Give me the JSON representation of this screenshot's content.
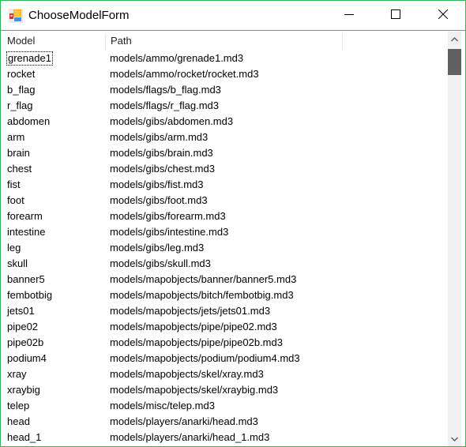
{
  "window": {
    "title": "ChooseModelForm",
    "icon": "app-form-icon",
    "controls": {
      "minimize": "minimize-icon",
      "maximize": "maximize-icon",
      "close": "close-icon"
    },
    "border_color": "#2fb25a"
  },
  "listview": {
    "columns": [
      {
        "label": "Model"
      },
      {
        "label": "Path"
      }
    ],
    "focused_index": 0,
    "rows": [
      {
        "model": "grenade1",
        "path": "models/ammo/grenade1.md3"
      },
      {
        "model": "rocket",
        "path": "models/ammo/rocket/rocket.md3"
      },
      {
        "model": "b_flag",
        "path": "models/flags/b_flag.md3"
      },
      {
        "model": "r_flag",
        "path": "models/flags/r_flag.md3"
      },
      {
        "model": "abdomen",
        "path": "models/gibs/abdomen.md3"
      },
      {
        "model": "arm",
        "path": "models/gibs/arm.md3"
      },
      {
        "model": "brain",
        "path": "models/gibs/brain.md3"
      },
      {
        "model": "chest",
        "path": "models/gibs/chest.md3"
      },
      {
        "model": "fist",
        "path": "models/gibs/fist.md3"
      },
      {
        "model": "foot",
        "path": "models/gibs/foot.md3"
      },
      {
        "model": "forearm",
        "path": "models/gibs/forearm.md3"
      },
      {
        "model": "intestine",
        "path": "models/gibs/intestine.md3"
      },
      {
        "model": "leg",
        "path": "models/gibs/leg.md3"
      },
      {
        "model": "skull",
        "path": "models/gibs/skull.md3"
      },
      {
        "model": "banner5",
        "path": "models/mapobjects/banner/banner5.md3"
      },
      {
        "model": "fembotbig",
        "path": "models/mapobjects/bitch/fembotbig.md3"
      },
      {
        "model": "jets01",
        "path": "models/mapobjects/jets/jets01.md3"
      },
      {
        "model": "pipe02",
        "path": "models/mapobjects/pipe/pipe02.md3"
      },
      {
        "model": "pipe02b",
        "path": "models/mapobjects/pipe/pipe02b.md3"
      },
      {
        "model": "podium4",
        "path": "models/mapobjects/podium/podium4.md3"
      },
      {
        "model": "xray",
        "path": "models/mapobjects/skel/xray.md3"
      },
      {
        "model": "xraybig",
        "path": "models/mapobjects/skel/xraybig.md3"
      },
      {
        "model": "telep",
        "path": "models/misc/telep.md3"
      },
      {
        "model": "head",
        "path": "models/players/anarki/head.md3"
      },
      {
        "model": "head_1",
        "path": "models/players/anarki/head_1.md3"
      }
    ]
  },
  "scrollbar": {
    "up_icon": "chevron-up-icon",
    "down_icon": "chevron-down-icon",
    "position_fraction": 0.0
  }
}
